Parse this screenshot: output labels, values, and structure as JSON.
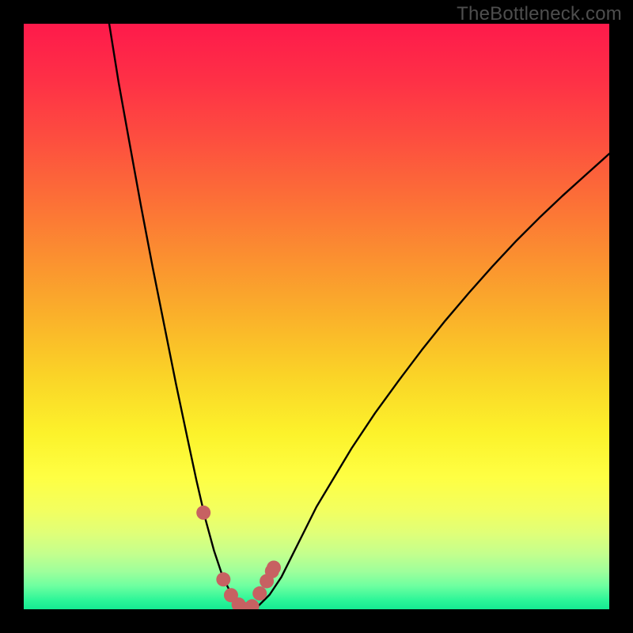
{
  "watermark": "TheBottleneck.com",
  "colors": {
    "black": "#000000",
    "curve": "#000000",
    "markers": "#c76162",
    "watermark": "#4e4e4e"
  },
  "gradient_stops": [
    {
      "offset": 0.0,
      "color": "#fe1a4b"
    },
    {
      "offset": 0.1,
      "color": "#fe3146"
    },
    {
      "offset": 0.2,
      "color": "#fd4f3f"
    },
    {
      "offset": 0.3,
      "color": "#fc6f37"
    },
    {
      "offset": 0.4,
      "color": "#fb9030"
    },
    {
      "offset": 0.5,
      "color": "#fab12a"
    },
    {
      "offset": 0.6,
      "color": "#fad327"
    },
    {
      "offset": 0.7,
      "color": "#fcf22b"
    },
    {
      "offset": 0.775,
      "color": "#feff43"
    },
    {
      "offset": 0.83,
      "color": "#f3ff5f"
    },
    {
      "offset": 0.87,
      "color": "#e0ff78"
    },
    {
      "offset": 0.905,
      "color": "#c4ff8d"
    },
    {
      "offset": 0.935,
      "color": "#9fff9b"
    },
    {
      "offset": 0.96,
      "color": "#6effa0"
    },
    {
      "offset": 0.985,
      "color": "#2bf598"
    },
    {
      "offset": 1.0,
      "color": "#15ea92"
    }
  ],
  "chart_data": {
    "type": "line",
    "title": "",
    "xlabel": "",
    "ylabel": "",
    "xlim": [
      0,
      100
    ],
    "ylim": [
      0,
      100
    ],
    "x": [
      14.6,
      16.2,
      18.0,
      20.0,
      22.0,
      24.0,
      26.0,
      28.0,
      29.5,
      31.0,
      32.5,
      34.0,
      35.5,
      37.0,
      38.5,
      40.0,
      42.0,
      44.0,
      46.0,
      48.0,
      50.0,
      53.0,
      56.0,
      60.0,
      64.0,
      68.0,
      72.0,
      76.0,
      80.0,
      84.0,
      88.0,
      92.0,
      96.0,
      100.0
    ],
    "y": [
      100.0,
      90.0,
      80.0,
      69.0,
      58.5,
      48.5,
      38.5,
      29.0,
      22.0,
      15.5,
      10.0,
      5.5,
      2.5,
      0.5,
      0.0,
      0.5,
      2.5,
      5.5,
      9.5,
      13.5,
      17.5,
      22.5,
      27.5,
      33.5,
      39.0,
      44.3,
      49.3,
      54.0,
      58.5,
      62.8,
      66.8,
      70.6,
      74.2,
      77.8
    ],
    "markers": {
      "x": [
        30.7,
        34.1,
        35.4,
        36.7,
        37.8,
        39.0,
        40.3,
        41.5,
        42.4,
        42.7
      ],
      "y": [
        16.5,
        5.1,
        2.4,
        0.8,
        0.0,
        0.5,
        2.7,
        4.8,
        6.5,
        7.1
      ]
    }
  }
}
